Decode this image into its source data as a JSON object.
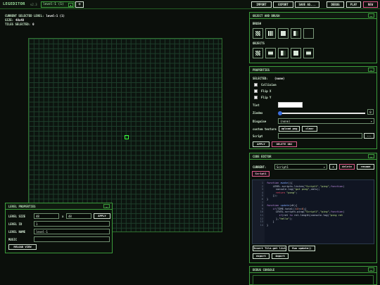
{
  "app": {
    "title": "LEGEDITOR",
    "version": "v2.3"
  },
  "topbar": {
    "level_selected": "level-1 (1)",
    "add_label": "+",
    "buttons": {
      "import": "IMPORT",
      "export": "EXPORT",
      "save": "SAVE AS...",
      "debug": "DEBUG",
      "play": "PLAY",
      "new": "NEW"
    }
  },
  "info": {
    "current_level_label": "CURRENT SELECTED LEVEL:",
    "current_level_value": "level-1 (1)",
    "size_label": "SIZE:",
    "size_value": "48x48",
    "tiles_label": "TILES SELECTED:",
    "tiles_value": "0"
  },
  "object_brush": {
    "title": "OBJECT AND BRUSH",
    "brush_label": "BRUSH",
    "objects_label": "OBJECTS",
    "brush_icons": [
      "grid-tile",
      "stripe-tile",
      "block-tile",
      "half-tile",
      "empty-tile"
    ],
    "object_icons": [
      "dots-object",
      "bar-object",
      "stripe-object",
      "block-object",
      "bar-object-2"
    ]
  },
  "properties": {
    "title": "PROPERTIES",
    "selected_label": "SELECTED:",
    "selected_value": "(none)",
    "collision": "Collision",
    "flipx": "Flip X",
    "flipy": "Flip Y",
    "tint": "Tint",
    "zindex": "Zindex",
    "zindex_value": "0",
    "disguise": "Disguise",
    "disguise_value": "(none)",
    "custom_texture": "custom texture",
    "upload": "upload png",
    "clear": "clear",
    "script": "Script",
    "script_btn": "...",
    "apply": "APPLY",
    "delete": "DELETE OBJ"
  },
  "code_editor": {
    "title": "CODE EDITOR",
    "current_label": "CURRENT:",
    "current_value": "Script1",
    "add": "+",
    "delete": "delete",
    "rename": "rename",
    "tab": "Script1",
    "line_numbers": "1\n2\n3\n4\n5\n6\n7\n8\n9\n10\n11\n12\n13\n14",
    "insert_btn": "Insert Tile.get list",
    "run_btn": "Run update()",
    "export": "export",
    "import": "import"
  },
  "debug": {
    "title": "DEBUG CONSOLE"
  },
  "level_properties": {
    "title": "LEVEL PROPERTIES",
    "size_label": "LEVEL SIZE",
    "width": "48",
    "x": "x",
    "height": "48",
    "apply": "APPLY",
    "id_label": "LEVEL ID",
    "id_value": "1",
    "name_label": "LEVEL NAME",
    "name_value": "level-1",
    "music_label": "MUSIC",
    "reload": "RELOAD VIEW"
  },
  "colors": {
    "accent": "#3b9c3b",
    "delete": "#e05c8c",
    "cursor": "#37ff37"
  }
}
